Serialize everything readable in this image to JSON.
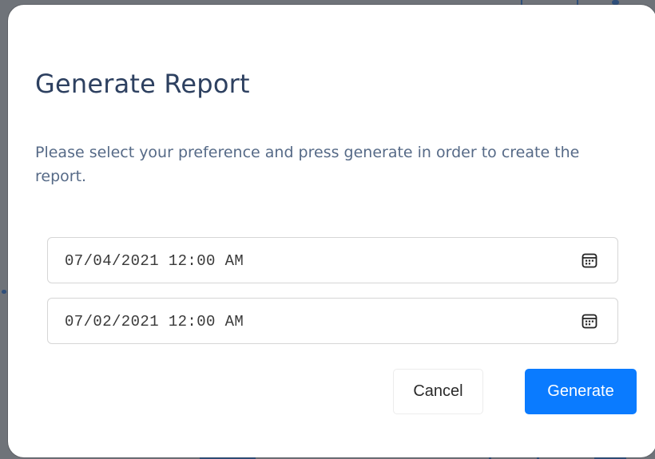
{
  "modal": {
    "title": "Generate Report",
    "description": "Please select your preference and press generate in order to create the report."
  },
  "date_fields": [
    {
      "value": "07/04/2021 12:00 AM",
      "icon": "calendar-icon"
    },
    {
      "value": "07/02/2021 12:00 AM",
      "icon": "calendar-icon"
    }
  ],
  "actions": {
    "cancel_label": "Cancel",
    "generate_label": "Generate"
  },
  "colors": {
    "title": "#2d4060",
    "description": "#566a87",
    "primary": "#0a7bff",
    "overlay": "#6f7379"
  }
}
